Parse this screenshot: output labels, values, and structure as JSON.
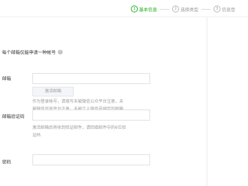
{
  "steps": [
    {
      "number": "1",
      "label": "基本信息"
    },
    {
      "number": "2",
      "label": "选择类型"
    },
    {
      "number": "3",
      "label": "信息登"
    }
  ],
  "form": {
    "notice": "每个邮箱仅能申请一种帐号",
    "email": {
      "label": "邮箱",
      "value": "",
      "activate_button": "激活邮箱",
      "tip_line1": "作为登录帐号，请填写未被微信公众平台注册，未",
      "tip_line2": "被微信开放平台注册，未被个人微信号绑定的邮箱"
    },
    "code": {
      "label": "邮箱验证码",
      "value": "",
      "tip_line1": "激活邮箱后将收到验证邮件，请回填邮件中的6位验",
      "tip_line2": "证码"
    },
    "password": {
      "label": "密码",
      "value": ""
    }
  },
  "colors": {
    "accent": "#1aad19",
    "muted": "#9a9a9a"
  }
}
